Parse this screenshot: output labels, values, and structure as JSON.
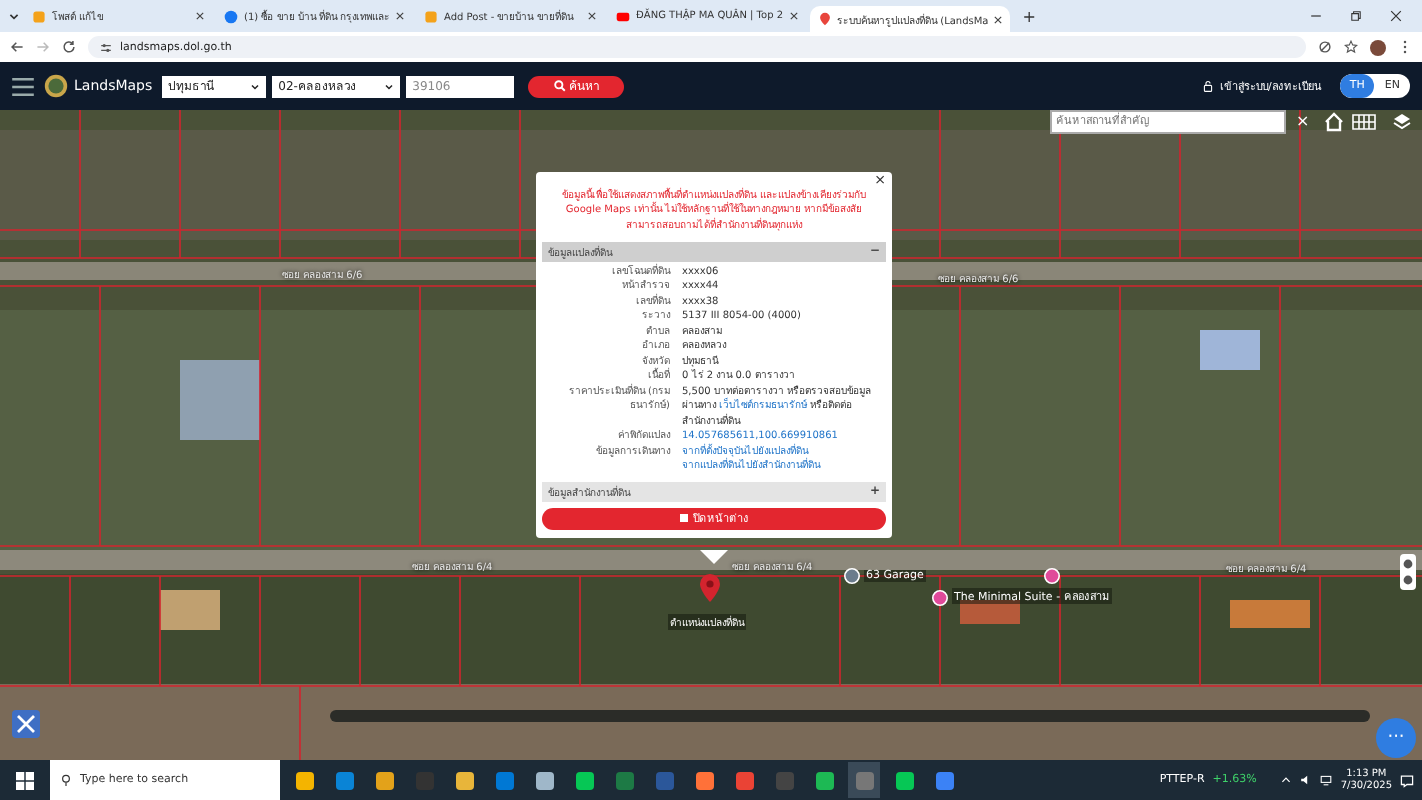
{
  "browser": {
    "tabs": [
      {
        "title": "โพสต์ แก้ไข",
        "kind": "page",
        "selected": false
      },
      {
        "title": "(1) ซื้อ ขาย บ้าน ที่ดิน กรุงเทพและ",
        "kind": "social",
        "selected": false
      },
      {
        "title": "Add Post - ขายบ้าน ขายที่ดิน",
        "kind": "page",
        "selected": false
      },
      {
        "title": "ĐĂNG THẬP MA QUÂN | Top 2",
        "kind": "video",
        "selected": false
      },
      {
        "title": "ระบบค้นหารูปแปลงที่ดิน (LandsMa",
        "kind": "map",
        "selected": true
      }
    ],
    "new_tab": "+",
    "url": "landsmaps.dol.go.th"
  },
  "header": {
    "logo": "LandsMaps",
    "province": "ปทุมธานี",
    "district": "02-คลองหลวง",
    "parcel_no": "39106",
    "search_button": "ค้นหา",
    "login": "เข้าสู่ระบบ/ลงทะเบียน",
    "languages": [
      {
        "label": "TH",
        "selected": true
      },
      {
        "label": "EN",
        "selected": false
      }
    ]
  },
  "map": {
    "search": {
      "placeholder": "ค้นหาสถานที่สำคัญ"
    },
    "close": "×",
    "labels": [
      {
        "text": "ซอย คลองสาม 6/6",
        "kind": "road"
      },
      {
        "text": "ซอย คลองสาม 6/6",
        "kind": "road"
      },
      {
        "text": "ซอย คลองสาม 6/4",
        "kind": "road"
      },
      {
        "text": "ซอย คลองสาม 6/4",
        "kind": "road"
      },
      {
        "text": "ซอย คลองสาม 6/4",
        "kind": "road"
      },
      {
        "text": "63 Garage",
        "kind": "place"
      },
      {
        "text": "The Minimal Suite - คลองสาม",
        "kind": "place"
      }
    ],
    "pin_label": "ตำแหน่งแปลงที่ดิน",
    "more": "···"
  },
  "popup": {
    "close": "×",
    "warning": "ข้อมูลนี้เพื่อใช้แสดงสภาพพื้นที่ตำแหน่งแปลงที่ดิน และแปลงข้างเคียงร่วมกับ Google Maps เท่านั้น ไม่ใช้หลักฐานที่ใช้ในทางกฎหมาย หากมีข้อสงสัยสามารถสอบถามได้ที่สำนักงานที่ดินทุกแห่ง",
    "sections": [
      {
        "title": "ข้อมูลแปลงที่ดิน",
        "toggle": "−",
        "expanded": true,
        "rows": [
          {
            "label": "เลขโฉนดที่ดิน",
            "kind": "text",
            "parts": [
              {
                "text": "xxxx06",
                "kind": "plain"
              }
            ]
          },
          {
            "label": "หน้าสำรวจ",
            "kind": "text",
            "parts": [
              {
                "text": "xxxx44",
                "kind": "plain"
              }
            ]
          },
          {
            "label": "เลขที่ดิน",
            "kind": "text",
            "parts": [
              {
                "text": "xxxx38",
                "kind": "plain"
              }
            ]
          },
          {
            "label": "ระวาง",
            "kind": "text",
            "parts": [
              {
                "text": "5137 III 8054-00 (4000)",
                "kind": "plain"
              }
            ]
          },
          {
            "label": "ตำบล",
            "kind": "text",
            "parts": [
              {
                "text": "คลองสาม",
                "kind": "plain"
              }
            ]
          },
          {
            "label": "อำเภอ",
            "kind": "text",
            "parts": [
              {
                "text": "คลองหลวง",
                "kind": "plain"
              }
            ]
          },
          {
            "label": "จังหวัด",
            "kind": "text",
            "parts": [
              {
                "text": "ปทุมธานี",
                "kind": "plain"
              }
            ]
          },
          {
            "label": "เนื้อที่",
            "kind": "text",
            "parts": [
              {
                "text": "0 ไร่ 2 งาน 0.0 ตารางวา",
                "kind": "plain"
              }
            ]
          },
          {
            "label": "ราคาประเมินที่ดิน (กรมธนารักษ์)",
            "kind": "text",
            "parts": [
              {
                "text": "5,500 บาทต่อตารางวา หรือตรวจสอบข้อมูลผ่านทาง ",
                "kind": "plain"
              },
              {
                "text": "เว็บไซต์กรมธนารักษ์",
                "kind": "link"
              },
              {
                "text": " หรือติดต่อสำนักงานที่ดิน",
                "kind": "plain"
              }
            ]
          },
          {
            "label": "ค่าพิกัดแปลง",
            "kind": "text",
            "parts": [
              {
                "text": "14.057685611,100.669910861",
                "kind": "link"
              }
            ]
          },
          {
            "label": "ข้อมูลการเดินทาง",
            "kind": "list",
            "parts": [
              {
                "text": "จากที่ตั้งปัจจุบันไปยังแปลงที่ดิน",
                "kind": "link"
              },
              {
                "text": "จากแปลงที่ดินไปยังสำนักงานที่ดิน",
                "kind": "link"
              }
            ]
          }
        ]
      },
      {
        "title": "ข้อมูลสำนักงานที่ดิน",
        "toggle": "+",
        "expanded": false
      }
    ],
    "button": "ปิดหน้าต่าง"
  },
  "taskbar": {
    "search_placeholder": "Type here to search",
    "stock": {
      "name": "PTTEP-R",
      "change": "+1.63%"
    },
    "time": "1:13 PM",
    "date": "7/30/2025"
  }
}
